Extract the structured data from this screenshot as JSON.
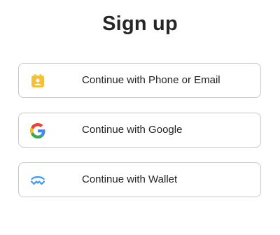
{
  "title": "Sign up",
  "options": [
    {
      "label": "Continue with Phone or Email",
      "icon": "contact-card-icon"
    },
    {
      "label": "Continue with Google",
      "icon": "google-icon"
    },
    {
      "label": "Continue with Wallet",
      "icon": "walletconnect-icon"
    }
  ],
  "colors": {
    "contact_icon": "#f5bf3a",
    "google_blue": "#4285F4",
    "google_red": "#EA4335",
    "google_yellow": "#FBBC05",
    "google_green": "#34A853",
    "wallet_icon": "#3b99fc",
    "border": "#c9c9c9"
  }
}
